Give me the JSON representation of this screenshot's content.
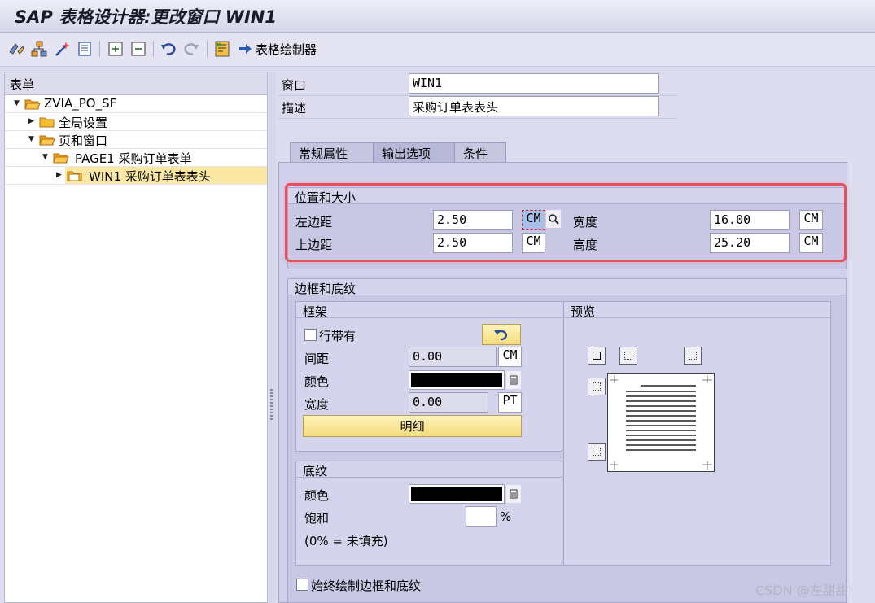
{
  "window": {
    "title": "SAP 表格设计器:更改窗口 WIN1"
  },
  "toolbar": {
    "icons": [
      "display-change-icon",
      "hierarchy-icon",
      "wand-icon",
      "print-preview-icon",
      "expand-icon",
      "collapse-icon",
      "undo-icon",
      "redo-icon",
      "form-check-icon"
    ],
    "form_painter": "表格绘制器"
  },
  "tree": {
    "header": "表单",
    "items": [
      {
        "label": "ZVIA_PO_SF",
        "expanded": true
      },
      {
        "label": "全局设置",
        "expanded": false
      },
      {
        "label": "页和窗口",
        "expanded": true
      },
      {
        "label": "PAGE1 采购订单表单",
        "expanded": true
      },
      {
        "label": "WIN1 采购订单表表头",
        "expanded": false,
        "selected": true
      }
    ]
  },
  "header": {
    "window_label": "窗口",
    "window_value": "WIN1",
    "desc_label": "描述",
    "desc_value": "采购订单表表头"
  },
  "tabs": [
    {
      "label": "常规属性",
      "active": false
    },
    {
      "label": "输出选项",
      "active": true
    },
    {
      "label": "条件",
      "active": false
    }
  ],
  "position": {
    "title": "位置和大小",
    "left_margin_label": "左边距",
    "left_margin_value": "2.50",
    "left_margin_unit": "CM",
    "width_label": "宽度",
    "width_value": "16.00",
    "width_unit": "CM",
    "top_margin_label": "上边距",
    "top_margin_value": "2.50",
    "top_margin_unit": "CM",
    "height_label": "高度",
    "height_value": "25.20",
    "height_unit": "CM"
  },
  "borders": {
    "title": "边框和底纹",
    "frame": {
      "title": "框架",
      "row_with_label": "行带有",
      "row_with_checked": false,
      "spacing_label": "间距",
      "spacing_value": "0.00",
      "spacing_unit": "CM",
      "color_label": "颜色",
      "color_value": "#000000",
      "width_label": "宽度",
      "width_value": "0.00",
      "width_unit": "PT",
      "detail_button": "明细"
    },
    "shading": {
      "title": "底纹",
      "color_label": "颜色",
      "color_value": "#000000",
      "saturation_label": "饱和",
      "saturation_value": "",
      "saturation_unit": "%",
      "hint": "(0% = 未填充)"
    },
    "preview_title": "预览",
    "always_draw_label": "始终绘制边框和底纹",
    "always_draw_checked": false
  },
  "watermark": "CSDN @左甜甜",
  "colors": {
    "accent": "#e6505c",
    "selected": "#fbe8a4",
    "panel": "#d0d0ea"
  }
}
